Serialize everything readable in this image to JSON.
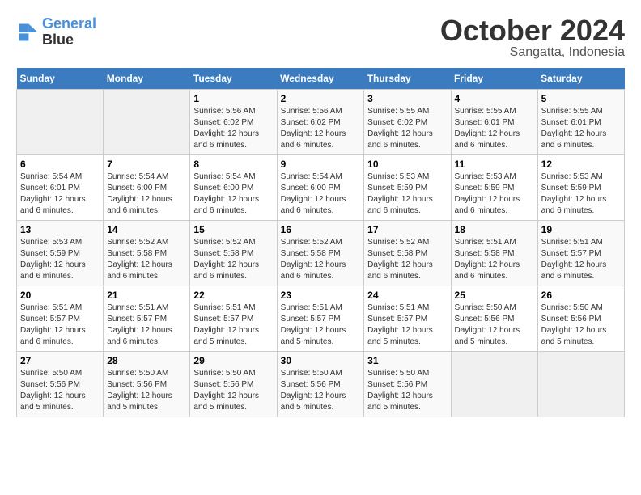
{
  "header": {
    "logo_line1": "General",
    "logo_line2": "Blue",
    "month": "October 2024",
    "location": "Sangatta, Indonesia"
  },
  "days_of_week": [
    "Sunday",
    "Monday",
    "Tuesday",
    "Wednesday",
    "Thursday",
    "Friday",
    "Saturday"
  ],
  "weeks": [
    [
      {
        "day": "",
        "empty": true
      },
      {
        "day": "",
        "empty": true
      },
      {
        "day": "1",
        "sunrise": "5:56 AM",
        "sunset": "6:02 PM",
        "daylight": "12 hours and 6 minutes."
      },
      {
        "day": "2",
        "sunrise": "5:56 AM",
        "sunset": "6:02 PM",
        "daylight": "12 hours and 6 minutes."
      },
      {
        "day": "3",
        "sunrise": "5:55 AM",
        "sunset": "6:02 PM",
        "daylight": "12 hours and 6 minutes."
      },
      {
        "day": "4",
        "sunrise": "5:55 AM",
        "sunset": "6:01 PM",
        "daylight": "12 hours and 6 minutes."
      },
      {
        "day": "5",
        "sunrise": "5:55 AM",
        "sunset": "6:01 PM",
        "daylight": "12 hours and 6 minutes."
      }
    ],
    [
      {
        "day": "6",
        "sunrise": "5:54 AM",
        "sunset": "6:01 PM",
        "daylight": "12 hours and 6 minutes."
      },
      {
        "day": "7",
        "sunrise": "5:54 AM",
        "sunset": "6:00 PM",
        "daylight": "12 hours and 6 minutes."
      },
      {
        "day": "8",
        "sunrise": "5:54 AM",
        "sunset": "6:00 PM",
        "daylight": "12 hours and 6 minutes."
      },
      {
        "day": "9",
        "sunrise": "5:54 AM",
        "sunset": "6:00 PM",
        "daylight": "12 hours and 6 minutes."
      },
      {
        "day": "10",
        "sunrise": "5:53 AM",
        "sunset": "5:59 PM",
        "daylight": "12 hours and 6 minutes."
      },
      {
        "day": "11",
        "sunrise": "5:53 AM",
        "sunset": "5:59 PM",
        "daylight": "12 hours and 6 minutes."
      },
      {
        "day": "12",
        "sunrise": "5:53 AM",
        "sunset": "5:59 PM",
        "daylight": "12 hours and 6 minutes."
      }
    ],
    [
      {
        "day": "13",
        "sunrise": "5:53 AM",
        "sunset": "5:59 PM",
        "daylight": "12 hours and 6 minutes."
      },
      {
        "day": "14",
        "sunrise": "5:52 AM",
        "sunset": "5:58 PM",
        "daylight": "12 hours and 6 minutes."
      },
      {
        "day": "15",
        "sunrise": "5:52 AM",
        "sunset": "5:58 PM",
        "daylight": "12 hours and 6 minutes."
      },
      {
        "day": "16",
        "sunrise": "5:52 AM",
        "sunset": "5:58 PM",
        "daylight": "12 hours and 6 minutes."
      },
      {
        "day": "17",
        "sunrise": "5:52 AM",
        "sunset": "5:58 PM",
        "daylight": "12 hours and 6 minutes."
      },
      {
        "day": "18",
        "sunrise": "5:51 AM",
        "sunset": "5:58 PM",
        "daylight": "12 hours and 6 minutes."
      },
      {
        "day": "19",
        "sunrise": "5:51 AM",
        "sunset": "5:57 PM",
        "daylight": "12 hours and 6 minutes."
      }
    ],
    [
      {
        "day": "20",
        "sunrise": "5:51 AM",
        "sunset": "5:57 PM",
        "daylight": "12 hours and 6 minutes."
      },
      {
        "day": "21",
        "sunrise": "5:51 AM",
        "sunset": "5:57 PM",
        "daylight": "12 hours and 6 minutes."
      },
      {
        "day": "22",
        "sunrise": "5:51 AM",
        "sunset": "5:57 PM",
        "daylight": "12 hours and 5 minutes."
      },
      {
        "day": "23",
        "sunrise": "5:51 AM",
        "sunset": "5:57 PM",
        "daylight": "12 hours and 5 minutes."
      },
      {
        "day": "24",
        "sunrise": "5:51 AM",
        "sunset": "5:57 PM",
        "daylight": "12 hours and 5 minutes."
      },
      {
        "day": "25",
        "sunrise": "5:50 AM",
        "sunset": "5:56 PM",
        "daylight": "12 hours and 5 minutes."
      },
      {
        "day": "26",
        "sunrise": "5:50 AM",
        "sunset": "5:56 PM",
        "daylight": "12 hours and 5 minutes."
      }
    ],
    [
      {
        "day": "27",
        "sunrise": "5:50 AM",
        "sunset": "5:56 PM",
        "daylight": "12 hours and 5 minutes."
      },
      {
        "day": "28",
        "sunrise": "5:50 AM",
        "sunset": "5:56 PM",
        "daylight": "12 hours and 5 minutes."
      },
      {
        "day": "29",
        "sunrise": "5:50 AM",
        "sunset": "5:56 PM",
        "daylight": "12 hours and 5 minutes."
      },
      {
        "day": "30",
        "sunrise": "5:50 AM",
        "sunset": "5:56 PM",
        "daylight": "12 hours and 5 minutes."
      },
      {
        "day": "31",
        "sunrise": "5:50 AM",
        "sunset": "5:56 PM",
        "daylight": "12 hours and 5 minutes."
      },
      {
        "day": "",
        "empty": true
      },
      {
        "day": "",
        "empty": true
      }
    ]
  ]
}
